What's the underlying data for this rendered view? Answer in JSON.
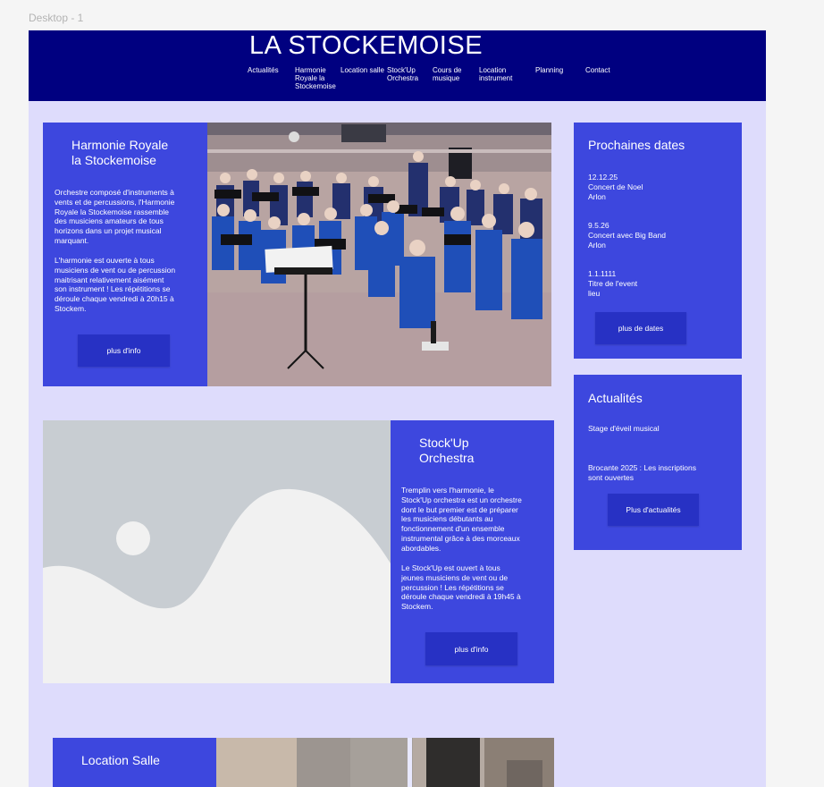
{
  "frame": {
    "label": "Desktop - 1"
  },
  "header": {
    "title": "LA STOCKEMOISE",
    "nav": [
      "Actualités",
      "Harmonie\nRoyale la\nStockemoise",
      "Location salle",
      "Stock'Up\nOrchestra",
      "Cours de\nmusique",
      "Location\ninstrument",
      "Planning",
      "Contact"
    ]
  },
  "harmonie": {
    "title": "Harmonie Royale\nla Stockemoise",
    "text1": "Orchestre composé d'instruments à\nvents et de percussions, l'Harmonie\nRoyale la Stockemoise rassemble\ndes musiciens amateurs de tous\nhorizons dans un projet musical\nmarquant.",
    "text2": "L'harmonie est ouverte à tous\nmusiciens de vent ou de percussion\nmaitrisant relativement aisément\nson instrument ! Les répétitions se\ndéroule chaque vendredi à 20h15 à\nStockem.",
    "button": "plus d'info",
    "photo_icon": "orchestra-photo"
  },
  "stockup": {
    "title": "Stock'Up\nOrchestra",
    "text1": "Tremplin vers l'harmonie, le\nStock'Up orchestra est un orchestre\ndont le but premier est de préparer\nles musiciens débutants au\nfonctionnement d'un ensemble\ninstrumental grâce à des morceaux\nabordables.",
    "text2": "Le Stock'Up est ouvert à tous\njeunes musiciens de vent ou de\npercussion ! Les répétitions se\ndéroule chaque vendredi à 19h45 à\nStockem.",
    "button": "plus d'info",
    "placeholder_icon": "image-placeholder-icon"
  },
  "dates": {
    "title": "Prochaines dates",
    "items": [
      {
        "date": "12.12.25",
        "event": "Concert de Noel",
        "place": "Arlon"
      },
      {
        "date": "9.5.26",
        "event": "Concert avec Big Band",
        "place": "Arlon"
      },
      {
        "date": "1.1.1111",
        "event": "Titre de l'event",
        "place": "lieu"
      }
    ],
    "button": "plus de dates"
  },
  "news": {
    "title": "Actualités",
    "items": [
      "Stage d'éveil musical",
      "Brocante 2025 : Les inscriptions\nsont ouvertes"
    ],
    "button": "Plus d'actualités"
  },
  "location": {
    "title": "Location Salle"
  },
  "colors": {
    "page_bg": "#dedcfc",
    "header_bg": "#000080",
    "card_bg": "#3d47de",
    "button_bg": "#2731c4"
  }
}
